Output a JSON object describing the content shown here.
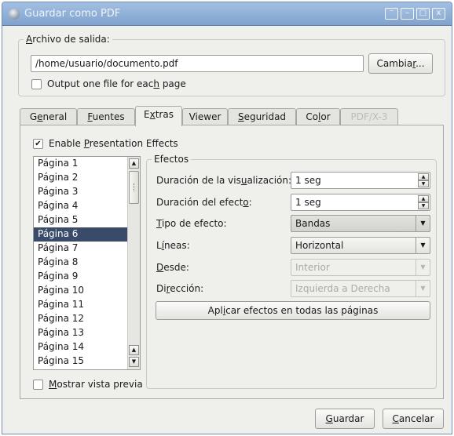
{
  "window": {
    "title": "Guardar como PDF",
    "controls": [
      "–",
      "□",
      "x"
    ]
  },
  "output": {
    "group_label_u": "A",
    "group_label_rest": "rchivo de salida:",
    "path_value": "/home/usuario/documento.pdf",
    "change_button_pre": "Cambia",
    "change_button_u": "r",
    "change_button_post": "...",
    "one_file_label_pre": "Output one file for eac",
    "one_file_label_u": "h",
    "one_file_label_post": " page",
    "one_file_checked": false
  },
  "tabs": [
    {
      "pre": "G",
      "u": "e",
      "post": "neral",
      "active": false,
      "disabled": false
    },
    {
      "pre": "",
      "u": "F",
      "post": "uentes",
      "active": false,
      "disabled": false
    },
    {
      "pre": "E",
      "u": "x",
      "post": "tras",
      "active": true,
      "disabled": false
    },
    {
      "pre": "Viewer",
      "u": "",
      "post": "",
      "active": false,
      "disabled": false
    },
    {
      "pre": "",
      "u": "S",
      "post": "eguridad",
      "active": false,
      "disabled": false
    },
    {
      "pre": "Co",
      "u": "l",
      "post": "or",
      "active": false,
      "disabled": false
    },
    {
      "pre": "PDF/X-3",
      "u": "",
      "post": "",
      "active": false,
      "disabled": true
    }
  ],
  "extras": {
    "presentation_label_pre": "Enable ",
    "presentation_label_u": "P",
    "presentation_label_post": "resentation Effects",
    "presentation_checked": true,
    "pages": [
      "Página 1",
      "Página 2",
      "Página 3",
      "Página 4",
      "Página 5",
      "Página 6",
      "Página 7",
      "Página 8",
      "Página 9",
      "Página 10",
      "Página 11",
      "Página 12",
      "Página 13",
      "Página 14",
      "Página 15"
    ],
    "selected_page_index": 5,
    "preview_label_pre": "",
    "preview_label_u": "M",
    "preview_label_post": "ostrar vista previa",
    "preview_checked": false,
    "effects": {
      "group_label": "Efectos",
      "display_duration_pre": "Duración de la vis",
      "display_duration_u": "u",
      "display_duration_post": "alización:",
      "display_duration_value": "1 seg",
      "effect_duration_pre": "Duración del efect",
      "effect_duration_u": "o",
      "effect_duration_post": ":",
      "effect_duration_value": "1 seg",
      "type_pre": "",
      "type_u": "T",
      "type_post": "ipo de efecto:",
      "type_value": "Bandas",
      "lines_pre": "L",
      "lines_u": "í",
      "lines_post": "neas:",
      "lines_value": "Horizontal",
      "from_pre": "",
      "from_u": "D",
      "from_post": "esde:",
      "from_value": "Interior",
      "direction_pre": "Di",
      "direction_u": "r",
      "direction_post": "ección:",
      "direction_value": "Izquierda a Derecha",
      "apply_button_pre": "Apl",
      "apply_button_u": "i",
      "apply_button_post": "car efectos en todas las páginas"
    }
  },
  "footer": {
    "save_pre": "",
    "save_u": "G",
    "save_post": "uardar",
    "cancel_pre": "",
    "cancel_u": "C",
    "cancel_post": "ancelar"
  },
  "colors": {
    "titlebar": "#8fb0d9",
    "selection": "#3a4b69",
    "window_bg": "#efefec"
  }
}
